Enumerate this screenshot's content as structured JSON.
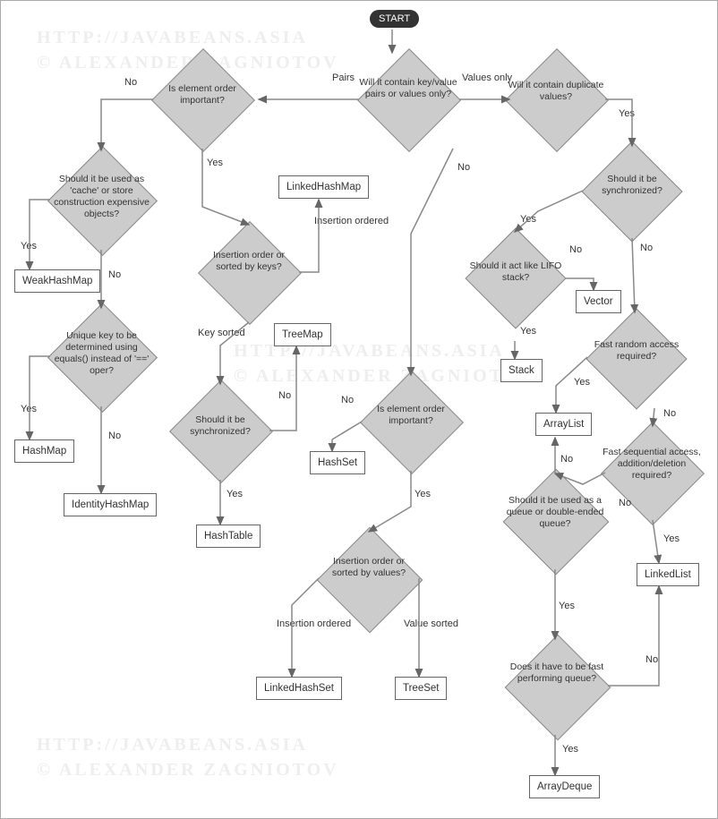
{
  "start": "START",
  "watermarks": {
    "url": "HTTP://JAVABEANS.ASIA",
    "copyright": "© ALEXANDER ZAGNIOTOV"
  },
  "decisions": {
    "q_pairs": "Will it contain key/value pairs or values only?",
    "q_order_pairs": "Is element order important?",
    "q_cache": "Should it be used as 'cache' or store construction expensive objects?",
    "q_unique_key": "Unique key to be determined using equals() instead of '==' oper?",
    "q_ins_keys": "Insertion order or sorted by keys?",
    "q_sync_map": "Should it be synchronized?",
    "q_dup": "Will it contain duplicate values?",
    "q_order_vals": "Is element order important?",
    "q_ins_vals": "Insertion order or sorted by values?",
    "q_sync_list": "Should it be synchronized?",
    "q_lifo": "Should it act like LIFO stack?",
    "q_random": "Fast random access required?",
    "q_queue": "Should it be used as a queue or double-ended queue?",
    "q_seq": "Fast sequential access, addition/deletion required?",
    "q_fastq": "Does it have to be fast performing queue?"
  },
  "results": {
    "WeakHashMap": "WeakHashMap",
    "HashMap": "HashMap",
    "IdentityHashMap": "IdentityHashMap",
    "LinkedHashMap": "LinkedHashMap",
    "TreeMap": "TreeMap",
    "HashTable": "HashTable",
    "HashSet": "HashSet",
    "LinkedHashSet": "LinkedHashSet",
    "TreeSet": "TreeSet",
    "Vector": "Vector",
    "Stack": "Stack",
    "ArrayList": "ArrayList",
    "LinkedList": "LinkedList",
    "ArrayDeque": "ArrayDeque"
  },
  "labels": {
    "Pairs": "Pairs",
    "ValuesOnly": "Values only",
    "Yes": "Yes",
    "No": "No",
    "InsOrdered": "Insertion ordered",
    "KeySorted": "Key sorted",
    "ValSorted": "Value sorted"
  }
}
